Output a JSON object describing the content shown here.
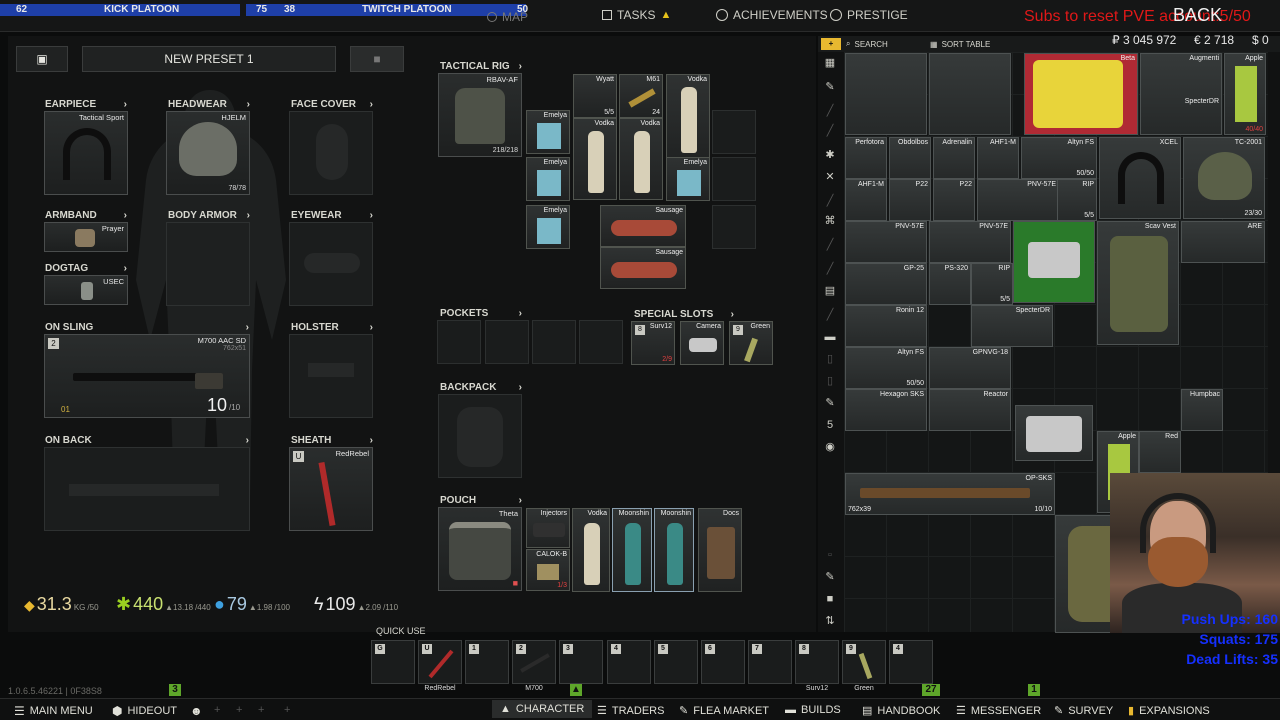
{
  "topbar": {
    "seg1_num": "62",
    "seg1_name": "KICK PLATOON",
    "seg2_num1": "75",
    "seg2_num2": "38",
    "seg2_name": "TWITCH PLATOON",
    "seg2_num3": "50",
    "map": "MAP",
    "tasks": "TASKS",
    "achievements": "ACHIEVEMENTS",
    "prestige": "PRESTIGE",
    "subs_overlay": "Subs to reset PVE account:5/50",
    "back": "BACK"
  },
  "preset": {
    "name": "NEW PRESET 1"
  },
  "slots": {
    "earpiece": {
      "label": "EARPIECE",
      "item": "Tactical Sport"
    },
    "headwear": {
      "label": "HEADWEAR",
      "item": "HJELM",
      "durability": "78/78"
    },
    "face_cover": {
      "label": "FACE COVER"
    },
    "armband": {
      "label": "ARMBAND",
      "item": "Prayer"
    },
    "body_armor": {
      "label": "BODY ARMOR"
    },
    "eyewear": {
      "label": "EYEWEAR"
    },
    "dogtag": {
      "label": "DOGTAG",
      "item": "USEC"
    },
    "on_sling": {
      "label": "ON SLING",
      "item": "M700 AAC SD",
      "caliber": "762x51",
      "ammo": "10",
      "ammo_max": "/10",
      "key": "2",
      "badge": "01"
    },
    "holster": {
      "label": "HOLSTER"
    },
    "on_back": {
      "label": "ON BACK"
    },
    "sheath": {
      "label": "SHEATH",
      "item": "RedRebel",
      "key": "U"
    },
    "tactical_rig": {
      "label": "TACTICAL RIG",
      "item": "RBAV-AF",
      "durability": "218/218"
    },
    "pockets": {
      "label": "POCKETS"
    },
    "special_slots": {
      "label": "SPECIAL SLOTS",
      "items": [
        {
          "key": "8",
          "name": "Surv12",
          "count": "2/9"
        },
        {
          "key": "",
          "name": "Camera",
          "count": ""
        },
        {
          "key": "9",
          "name": "Green",
          "count": ""
        }
      ]
    },
    "backpack": {
      "label": "BACKPACK"
    },
    "pouch": {
      "label": "POUCH",
      "item": "Theta"
    }
  },
  "rig_items": [
    {
      "name": "Wyatt",
      "count": "5/5"
    },
    {
      "name": "M61",
      "count": "24"
    },
    {
      "name": "Vodka",
      "count": ""
    },
    {
      "name": "Emelya"
    },
    {
      "name": "Vodka"
    },
    {
      "name": "Vodka"
    },
    {
      "name": "Emelya"
    },
    {
      "name": "Emelya"
    },
    {
      "name": "Emelya"
    },
    {
      "name": "Sausage"
    },
    {
      "name": "Sausage"
    }
  ],
  "pouch_items": [
    {
      "name": "Injectors"
    },
    {
      "name": "Vodka"
    },
    {
      "name": "Moonshin"
    },
    {
      "name": "Moonshin"
    },
    {
      "name": "Docs"
    },
    {
      "name": "CALOK-B",
      "count": "1/3"
    }
  ],
  "stats": {
    "weight": "31.3",
    "weight_unit": "KG",
    "weight_max": "/50",
    "health": "440",
    "health_delta": "▲13.18",
    "health_max": "/440",
    "hydration": "79",
    "hydration_delta": "▲1.98",
    "hydration_max": "/100",
    "energy": "109",
    "energy_delta": "▲2.09",
    "energy_max": "/110"
  },
  "stash": {
    "search": "SEARCH",
    "sort": "SORT TABLE",
    "roubles": "₽ 3 045 972",
    "euros": "€ 2 718",
    "dollars": "$ 0",
    "items": [
      {
        "name": "Beta",
        "count": ""
      },
      {
        "name": "Augmenti",
        "count": ""
      },
      {
        "name": "SpecterDR",
        "count": ""
      },
      {
        "name": "Apple",
        "count": "40/40"
      },
      {
        "name": "Perfotora"
      },
      {
        "name": "Obdolbos"
      },
      {
        "name": "Adrenalin"
      },
      {
        "name": "AHF1-M"
      },
      {
        "name": "Altyn FS",
        "count": "50/50"
      },
      {
        "name": "XCEL"
      },
      {
        "name": "TC-2001",
        "count": "23/30"
      },
      {
        "name": "AHF1-M"
      },
      {
        "name": "P22"
      },
      {
        "name": "P22"
      },
      {
        "name": "PNV-57E"
      },
      {
        "name": "RIP",
        "count": "5/5"
      },
      {
        "name": "PNV-57E"
      },
      {
        "name": "PNV-57E"
      },
      {
        "name": "Scav Vest"
      },
      {
        "name": "ARE"
      },
      {
        "name": "GP-25"
      },
      {
        "name": "PS-320"
      },
      {
        "name": "RIP",
        "count": "5/5"
      },
      {
        "name": "Ronin 12"
      },
      {
        "name": "SpecterDR"
      },
      {
        "name": "Altyn FS",
        "count": "50/50"
      },
      {
        "name": "GPNVG-18"
      },
      {
        "name": "Hexagon SKS"
      },
      {
        "name": "Reactor"
      },
      {
        "name": "Humpbac"
      },
      {
        "name": "Apple"
      },
      {
        "name": "Red"
      },
      {
        "name": "OP-SKS",
        "count": "10/10",
        "caliber": "762x39"
      }
    ]
  },
  "quick_use": {
    "label": "QUICK USE",
    "slots": [
      {
        "key": "G",
        "label": ""
      },
      {
        "key": "U",
        "label": "RedRebel"
      },
      {
        "key": "1",
        "label": ""
      },
      {
        "key": "2",
        "label": "M700"
      },
      {
        "key": "3",
        "label": ""
      },
      {
        "key": "4",
        "label": ""
      },
      {
        "key": "5",
        "label": ""
      },
      {
        "key": "6",
        "label": ""
      },
      {
        "key": "7",
        "label": ""
      },
      {
        "key": "8",
        "label": "Surv12"
      },
      {
        "key": "9",
        "label": "Green"
      },
      {
        "key": "4",
        "label": ""
      }
    ]
  },
  "version": "1.0.6.5.46221 | 0F38S8",
  "bottom_badges": {
    "b1": "3",
    "b2": "27",
    "b3": "1"
  },
  "bottombar": {
    "main_menu": "MAIN MENU",
    "hideout": "HIDEOUT",
    "character": "CHARACTER",
    "traders": "TRADERS",
    "flea_market": "FLEA MARKET",
    "builds": "BUILDS",
    "handbook": "HANDBOOK",
    "messenger": "MESSENGER",
    "survey": "SURVEY",
    "expansions": "EXPANSIONS"
  },
  "overlay": {
    "pushups": "Push Ups: 160",
    "squats": "Squats: 175",
    "deadlifts": "Dead Lifts: 35"
  }
}
